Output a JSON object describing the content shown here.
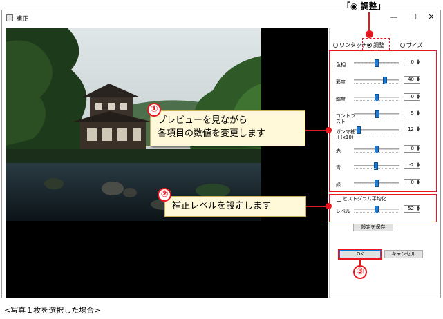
{
  "top_callout": {
    "label": "「◉ 調整」"
  },
  "window": {
    "title": "補正",
    "controls": {
      "minimize": "—",
      "maximize": "☐",
      "close": "✕"
    }
  },
  "modes": [
    {
      "label": "ワンタッチ",
      "selected": false
    },
    {
      "label": "調整",
      "selected": true
    },
    {
      "label": "サイズ",
      "selected": false
    }
  ],
  "adjustments": [
    {
      "label": "色相",
      "value": "0",
      "level_percent": 50
    },
    {
      "label": "彩度",
      "value": "40",
      "level_percent": 70
    },
    {
      "label": "輝度",
      "value": "0",
      "level_percent": 50
    },
    {
      "label": "コントラスト",
      "value": "5",
      "level_percent": 52
    },
    {
      "label": "ガンマ補正(x10)",
      "value": "12",
      "level_percent": 6
    },
    {
      "label": "赤",
      "value": "0",
      "level_percent": 50
    },
    {
      "label": "青",
      "value": "-2",
      "level_percent": 48
    },
    {
      "label": "緑",
      "value": "0",
      "level_percent": 50
    }
  ],
  "histogram": {
    "checkbox_label": "ヒストグラム平均化",
    "checked": false
  },
  "level": {
    "label": "レベル",
    "value": "52",
    "level_percent": 50
  },
  "buttons": {
    "save_settings": "設定を保存",
    "ok": "OK",
    "cancel": "キャンセル"
  },
  "callouts": [
    {
      "number": "①",
      "text_line1": "プレビューを見ながら",
      "text_line2": "各項目の数値を変更します"
    },
    {
      "number": "②",
      "text": "補正レベルを設定します"
    },
    {
      "number": "③"
    }
  ],
  "caption": "<写真１枚を選択した場合>",
  "colors": {
    "accent_red": "#e8171f",
    "callout_fill": "#fff9d9",
    "slider_thumb": "#1f7ad1"
  }
}
